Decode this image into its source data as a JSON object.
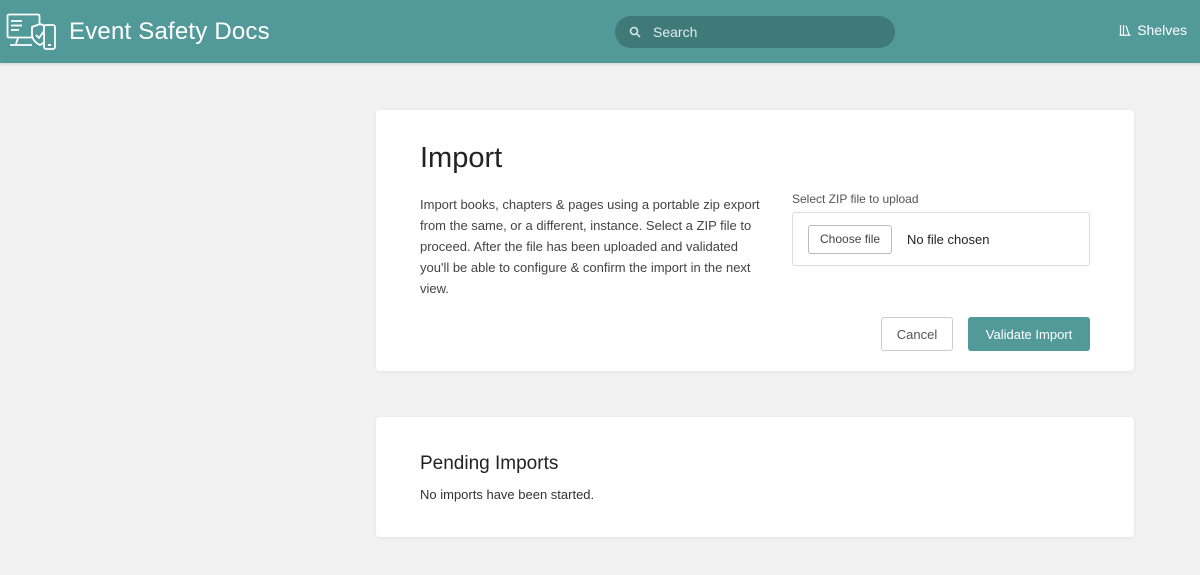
{
  "header": {
    "app_title": "Event Safety Docs",
    "logo_icon": "devices-shield-icon",
    "search": {
      "placeholder": "Search",
      "value": "",
      "icon": "search-icon"
    },
    "nav": {
      "shelves_label": "Shelves",
      "shelves_icon": "shelves-icon"
    },
    "colors": {
      "bar": "#529a9a",
      "search_bg": "#3f7a79"
    }
  },
  "import_card": {
    "title": "Import",
    "description": "Import books, chapters & pages using a portable zip export from the same, or a different, instance. Select a ZIP file to proceed. After the file has been uploaded and validated you'll be able to configure & confirm the import in the next view.",
    "upload_label": "Select ZIP file to upload",
    "choose_file_label": "Choose file",
    "file_status": "No file chosen",
    "cancel_label": "Cancel",
    "validate_label": "Validate Import",
    "accent_color": "#529a9a"
  },
  "pending_card": {
    "title": "Pending Imports",
    "empty_message": "No imports have been started."
  }
}
